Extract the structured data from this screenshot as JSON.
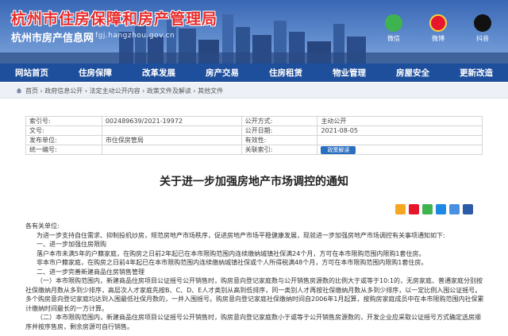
{
  "header": {
    "title": "杭州市住房保障和房产管理局",
    "subtitle": "杭州市房产信息网",
    "url": "fgj.hangzhou.gov.cn",
    "social": [
      {
        "label": "微信",
        "icon": "wechat-icon"
      },
      {
        "label": "微博",
        "icon": "weibo-icon"
      },
      {
        "label": "抖音",
        "icon": "douyin-icon"
      }
    ]
  },
  "nav": [
    "网站首页",
    "住房保障",
    "改革发展",
    "房产交易",
    "住房租赁",
    "物业管理",
    "房屋安全",
    "更新改造"
  ],
  "breadcrumb": "首页 › 政府信息公开 › 法定主动公开内容 › 政策文件及解读 › 其他文件",
  "meta": {
    "rows": [
      {
        "k1": "索引号:",
        "v1": "002489639/2021-19972",
        "k2": "公开方式:",
        "v2": "主动公开"
      },
      {
        "k1": "文号:",
        "v1": "",
        "k2": "公开日期:",
        "v2": "2021-08-05"
      },
      {
        "k1": "发布单位:",
        "v1": "市住保房管局",
        "k2": "有效性:",
        "v2": ""
      },
      {
        "k1": "统一编号:",
        "v1": "",
        "k2": "关联索引:",
        "v2": ""
      }
    ],
    "print_label": "政策解读"
  },
  "doc": {
    "title": "关于进一步加强房地产市场调控的通知",
    "paragraphs": [
      "各有关单位:",
      "为进一步支持自住需求、抑制投机炒房，规范房地产市场秩序，促进房地产市场平稳健康发展，现就进一步加强房地产市场调控有关事项通知如下:",
      "一、进一步加强住房限购",
      "落户本市未满5年的户籍家庭，在购房之日前2年起已在本市限购范围内连续缴纳城镇社保满24个月，方可在本市限购范围内限购1套住房。",
      "非本市户籍家庭，在购房之日前4年起已在本市限购范围内连续缴纳城镇社保或个人所得税满48个月，方可在本市限购范围内限购1套住房。",
      "二、进一步完善新建商品住房销售管理",
      "（一）本市限购范围内，新建商品住房项目公证摇号公开销售时，购房意向登记家庭数与公开销售房源数的比例大于或等于10:1的，无房家庭、普通家庭分别按社保缴纳月数从多到少排序，高层次人才家庭先按B、C、D、E人才类别从高到低排序，同一类别人才再按社保缴纳月数从多到少排序，以一定比例入围公证摇号。多个购房意向登记家庭均达到入围最低社保月数的，一并入围摇号。购房意向登记家庭社保缴纳时间自2006年1月起算，按购房家庭成员中在本市限购范围内社保累计缴纳时间最长的一方计算。",
      "（二）本市限购范围内，新建商品住房项目公证摇号公开销售时，购房意向登记家庭数小于或等于公开销售房源数的，开发企业应采取公证摇号方式确定选房顺序并按序售房，剩余房源可自行销售。"
    ]
  },
  "colors": {
    "nav_bg": "#1e4f9c",
    "title_red": "#e82b2b",
    "header_sky": "#3a67b4"
  }
}
